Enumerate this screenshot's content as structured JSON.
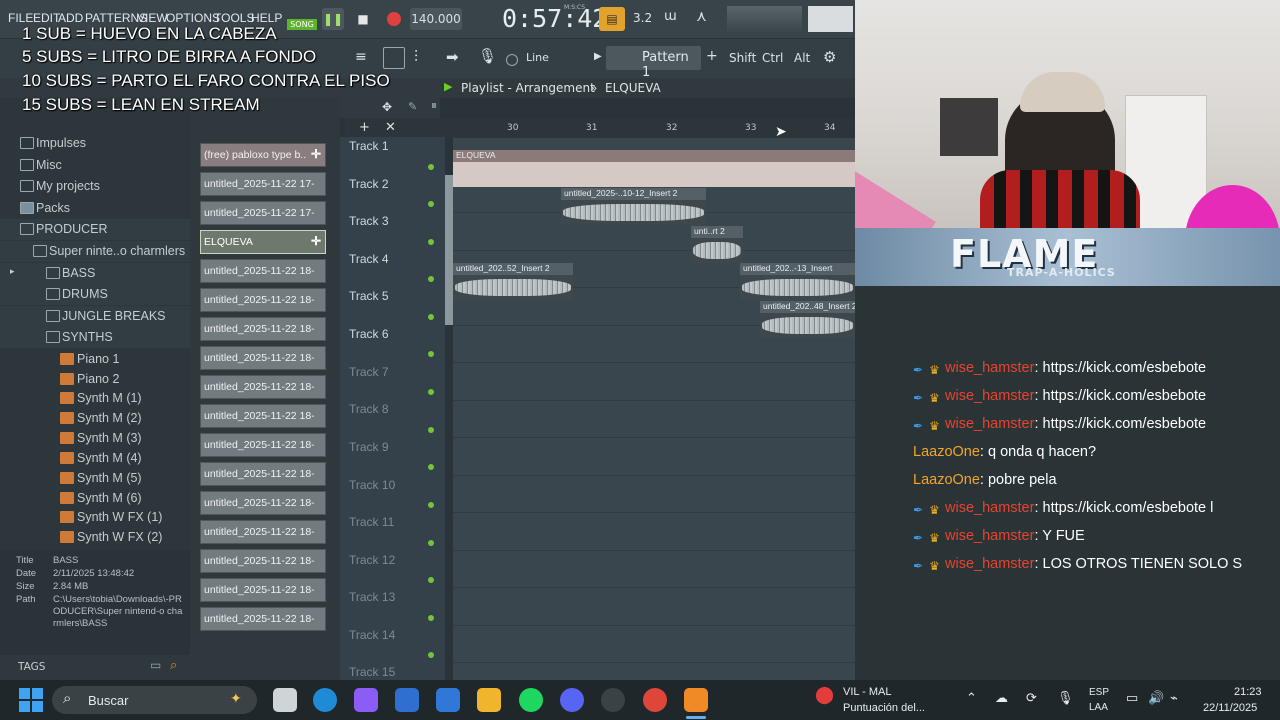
{
  "menu": {
    "items": [
      "FILE",
      "EDIT",
      "ADD",
      "PATTERNS",
      "VIEW",
      "OPTIONS",
      "TOOLS",
      "HELP"
    ]
  },
  "transport": {
    "tempo": "140.000",
    "time": "0:57:42",
    "time_unit": "M:S:CS",
    "song_badge": "SONG",
    "pattern_label": "Pattern 1",
    "line_label": "Line",
    "shift": "Shift",
    "ctrl": "Ctrl",
    "alt": "Alt",
    "step_label": "3.2"
  },
  "subs_overlay": [
    "1 SUB = HUEVO EN LA CABEZA",
    "5 SUBS = LITRO DE BIRRA A FONDO",
    "10 SUBS = PARTO EL FARO CONTRA EL PISO",
    "15 SUBS = LEAN EN STREAM"
  ],
  "playlist": {
    "title": "Playlist - Arrangement",
    "pattern": "ELQUEVA"
  },
  "browser": {
    "items": [
      {
        "label": "Impulses",
        "kind": "folder"
      },
      {
        "label": "Misc",
        "kind": "folder"
      },
      {
        "label": "My projects",
        "kind": "folder"
      },
      {
        "label": "Packs",
        "kind": "folder"
      },
      {
        "label": "PRODUCER",
        "kind": "folder-open"
      },
      {
        "label": "Super ninte..o charmlers",
        "kind": "folder-open"
      },
      {
        "label": "BASS",
        "kind": "folder"
      },
      {
        "label": "DRUMS",
        "kind": "folder"
      },
      {
        "label": "JUNGLE BREAKS",
        "kind": "folder"
      },
      {
        "label": "SYNTHS",
        "kind": "folder-open"
      },
      {
        "label": "Piano 1",
        "kind": "synth"
      },
      {
        "label": "Piano 2",
        "kind": "synth"
      },
      {
        "label": "Synth M (1)",
        "kind": "synth"
      },
      {
        "label": "Synth M (2)",
        "kind": "synth"
      },
      {
        "label": "Synth M (3)",
        "kind": "synth"
      },
      {
        "label": "Synth M (4)",
        "kind": "synth"
      },
      {
        "label": "Synth M (5)",
        "kind": "synth"
      },
      {
        "label": "Synth M (6)",
        "kind": "synth"
      },
      {
        "label": "Synth W FX (1)",
        "kind": "synth"
      },
      {
        "label": "Synth W FX (2)",
        "kind": "synth"
      }
    ]
  },
  "info": {
    "title_label": "Title",
    "title_value": "BASS",
    "date_label": "Date",
    "date_value": "2/11/2025 13:48:42",
    "size_label": "Size",
    "size_value": "2.84 MB",
    "path_label": "Path",
    "path_value": "C:\\Users\\tobia\\Downloads\\-PRODUCER\\Super nintend-o charmlers\\BASS",
    "tags_label": "TAGS"
  },
  "patterns": [
    "(free) pabloxo type b..",
    "untitled_2025-11-22 17-..",
    "untitled_2025-11-22 17-..",
    "ELQUEVA",
    "untitled_2025-11-22 18-..",
    "untitled_2025-11-22 18-..",
    "untitled_2025-11-22 18-..",
    "untitled_2025-11-22 18-..",
    "untitled_2025-11-22 18-..",
    "untitled_2025-11-22 18-..",
    "untitled_2025-11-22 18-..",
    "untitled_2025-11-22 18-..",
    "untitled_2025-11-22 18-..",
    "untitled_2025-11-22 18-..",
    "untitled_2025-11-22 18-..",
    "untitled_2025-11-22 18-..",
    "untitled_2025-11-22 18-.."
  ],
  "tracks": [
    "Track 1",
    "Track 2",
    "Track 3",
    "Track 4",
    "Track 5",
    "Track 6",
    "Track 7",
    "Track 8",
    "Track 9",
    "Track 10",
    "Track 11",
    "Track 12",
    "Track 13",
    "Track 14",
    "Track 15"
  ],
  "ruler": [
    "30",
    "31",
    "32",
    "33",
    "34"
  ],
  "clips": {
    "t1": "ELQUEVA",
    "t2": "untitled_2025-..10-12_Insert 2",
    "t3": "unti..rt 2",
    "t4a": "untitled_202..52_Insert 2",
    "t4b": "untitled_202..-13_Insert",
    "t5": "untitled_202..48_Insert 2"
  },
  "banner": {
    "title": "FLAME",
    "subtitle": "TRAP-A-HOLICS"
  },
  "chat": [
    {
      "user": "wise_hamster",
      "badges": true,
      "user_color": "#e8432f",
      "message": "https://kick.com/esbebote"
    },
    {
      "user": "wise_hamster",
      "badges": true,
      "user_color": "#e8432f",
      "message": "https://kick.com/esbebote"
    },
    {
      "user": "wise_hamster",
      "badges": true,
      "user_color": "#e8432f",
      "message": "https://kick.com/esbebote"
    },
    {
      "user": "LaazoOne",
      "badges": false,
      "user_color": "#f2a528",
      "message": "q onda q hacen?"
    },
    {
      "user": "LaazoOne",
      "badges": false,
      "user_color": "#f2a528",
      "message": "pobre pela"
    },
    {
      "user": "wise_hamster",
      "badges": true,
      "user_color": "#e8432f",
      "message": "https://kick.com/esbebote l"
    },
    {
      "user": "wise_hamster",
      "badges": true,
      "user_color": "#e8432f",
      "message": "Y FUE"
    },
    {
      "user": "wise_hamster",
      "badges": true,
      "user_color": "#e8432f",
      "message": "LOS OTROS TIENEN SOLO S"
    }
  ],
  "taskbar": {
    "search_placeholder": "Buscar",
    "weather_title": "VIL - MAL",
    "weather_sub": "Puntuación del...",
    "lang_top": "ESP",
    "lang_bottom": "LAA",
    "clock_time": "21:23",
    "clock_date": "22/11/2025"
  }
}
